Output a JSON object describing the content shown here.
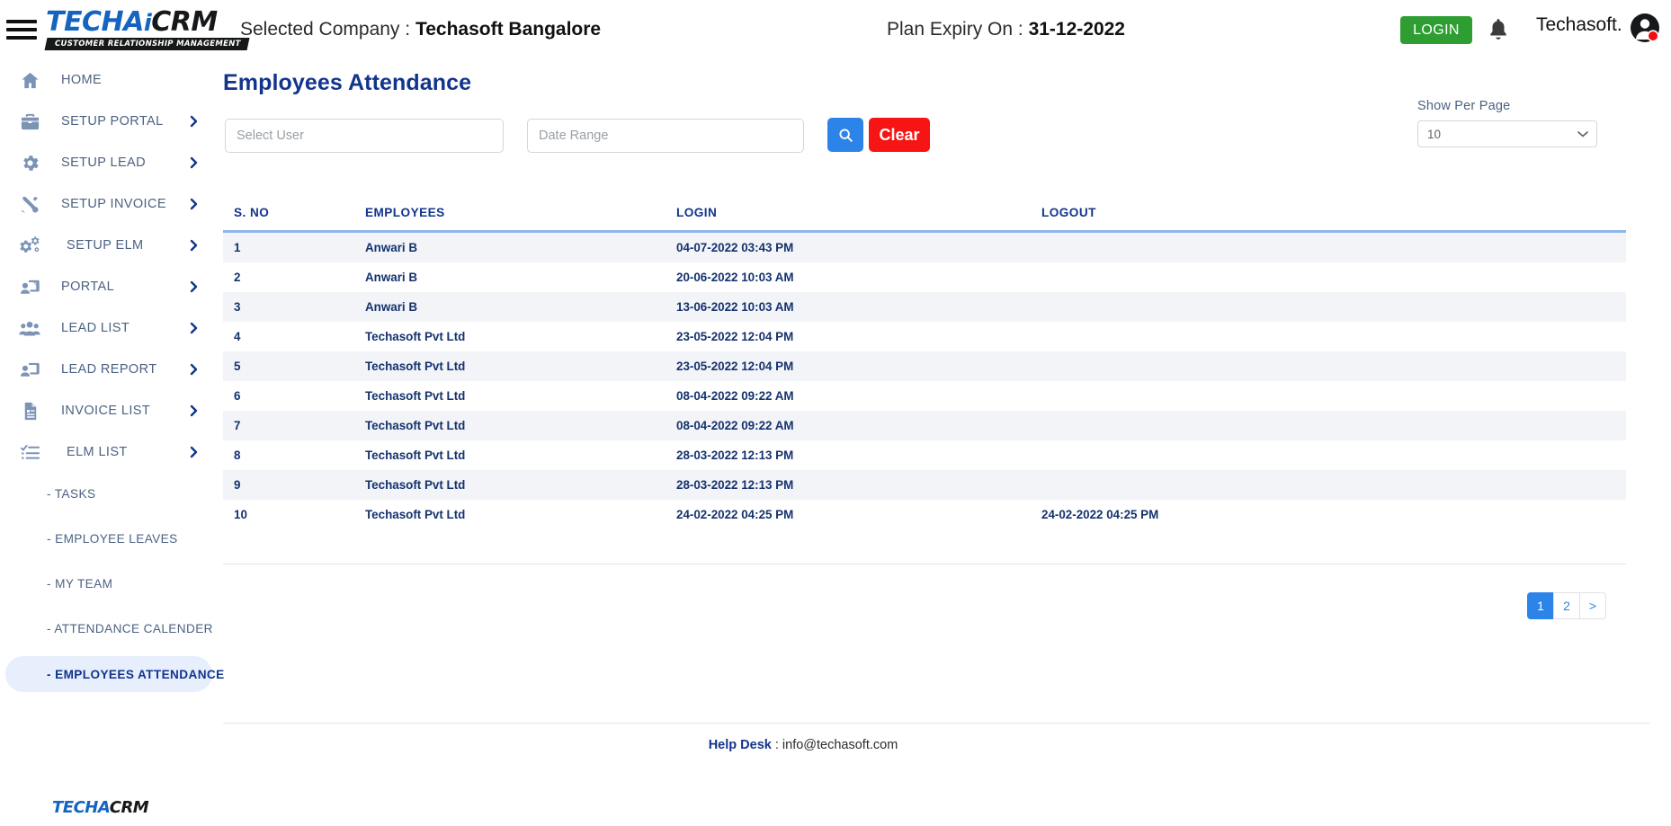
{
  "topbar": {
    "menu_icon": "hamburger-icon",
    "logo": {
      "part_blue": "TECHA",
      "part_i": "i",
      "part_dark": "CRM",
      "tagline": "CUSTOMER RELATIONSHIP MANAGEMENT"
    },
    "selected_company_label": "Selected Company : ",
    "selected_company_value": "Techasoft Bangalore",
    "plan_expiry_label": "Plan Expiry On : ",
    "plan_expiry_value": "31-12-2022",
    "login_label": "LOGIN",
    "bell_icon": "bell-icon",
    "user_name": "Techasoft.",
    "avatar_icon": "user-avatar-icon"
  },
  "sidebar": {
    "items": [
      {
        "label": "HOME",
        "icon": "home-icon",
        "chevron": false
      },
      {
        "label": "SETUP PORTAL",
        "icon": "toolbox-icon",
        "chevron": true
      },
      {
        "label": "SETUP LEAD",
        "icon": "gear-icon",
        "chevron": true
      },
      {
        "label": "SETUP INVOICE",
        "icon": "tools-icon",
        "chevron": true
      },
      {
        "label": "SETUP ELM",
        "icon": "gears-icon",
        "chevron": true
      },
      {
        "label": "PORTAL",
        "icon": "user-screen-icon",
        "chevron": true
      },
      {
        "label": "LEAD LIST",
        "icon": "users-group-icon",
        "chevron": true
      },
      {
        "label": "LEAD REPORT",
        "icon": "user-screen-icon",
        "chevron": true
      },
      {
        "label": "INVOICE LIST",
        "icon": "document-icon",
        "chevron": true
      },
      {
        "label": "ELM LIST",
        "icon": "checklist-icon",
        "chevron": true
      }
    ],
    "sub_items": [
      {
        "label": "- TASKS",
        "active": false
      },
      {
        "label": "- EMPLOYEE LEAVES",
        "active": false
      },
      {
        "label": "- MY TEAM",
        "active": false
      },
      {
        "label": "- ATTENDANCE CALENDER",
        "active": false
      },
      {
        "label": "- EMPLOYEES ATTENDANCE",
        "active": true
      }
    ],
    "footer_logo": {
      "part_blue": "TECHA",
      "part_dark": "CRM"
    }
  },
  "main": {
    "page_title": "Employees Attendance",
    "filters": {
      "user_placeholder": "Select User",
      "user_value": "",
      "date_range_placeholder": "Date Range",
      "date_range_value": "",
      "search_icon": "search-icon",
      "clear_label": "Clear"
    },
    "per_page": {
      "label": "Show Per Page",
      "value": "10",
      "chevron_icon": "chevron-down-icon"
    },
    "table": {
      "columns": [
        "S. NO",
        "EMPLOYEES",
        "LOGIN",
        "LOGOUT"
      ],
      "rows": [
        {
          "sno": "1",
          "employee": "Anwari B",
          "login": "04-07-2022 03:43 PM",
          "logout": ""
        },
        {
          "sno": "2",
          "employee": "Anwari B",
          "login": "20-06-2022 10:03 AM",
          "logout": ""
        },
        {
          "sno": "3",
          "employee": "Anwari B",
          "login": "13-06-2022 10:03 AM",
          "logout": ""
        },
        {
          "sno": "4",
          "employee": "Techasoft Pvt Ltd",
          "login": "23-05-2022 12:04 PM",
          "logout": ""
        },
        {
          "sno": "5",
          "employee": "Techasoft Pvt Ltd",
          "login": "23-05-2022 12:04 PM",
          "logout": ""
        },
        {
          "sno": "6",
          "employee": "Techasoft Pvt Ltd",
          "login": "08-04-2022 09:22 AM",
          "logout": ""
        },
        {
          "sno": "7",
          "employee": "Techasoft Pvt Ltd",
          "login": "08-04-2022 09:22 AM",
          "logout": ""
        },
        {
          "sno": "8",
          "employee": "Techasoft Pvt Ltd",
          "login": "28-03-2022 12:13 PM",
          "logout": ""
        },
        {
          "sno": "9",
          "employee": "Techasoft Pvt Ltd",
          "login": "28-03-2022 12:13 PM",
          "logout": ""
        },
        {
          "sno": "10",
          "employee": "Techasoft Pvt Ltd",
          "login": "24-02-2022 04:25 PM",
          "logout": "24-02-2022 04:25 PM"
        }
      ]
    },
    "pagination": [
      {
        "label": "1",
        "active": true
      },
      {
        "label": "2",
        "active": false
      },
      {
        "label": ">",
        "active": false
      }
    ]
  },
  "footer": {
    "helpdesk_label": "Help Desk",
    "helpdesk_value": " : info@techasoft.com"
  },
  "colors": {
    "brand_blue": "#1565c0",
    "navy": "#12348c",
    "accent_blue": "#2d84e8",
    "danger_red": "#f71414",
    "success_green": "#2e9e33",
    "sidebar_text": "#4c6283",
    "row_alt": "#f2f4f8"
  }
}
